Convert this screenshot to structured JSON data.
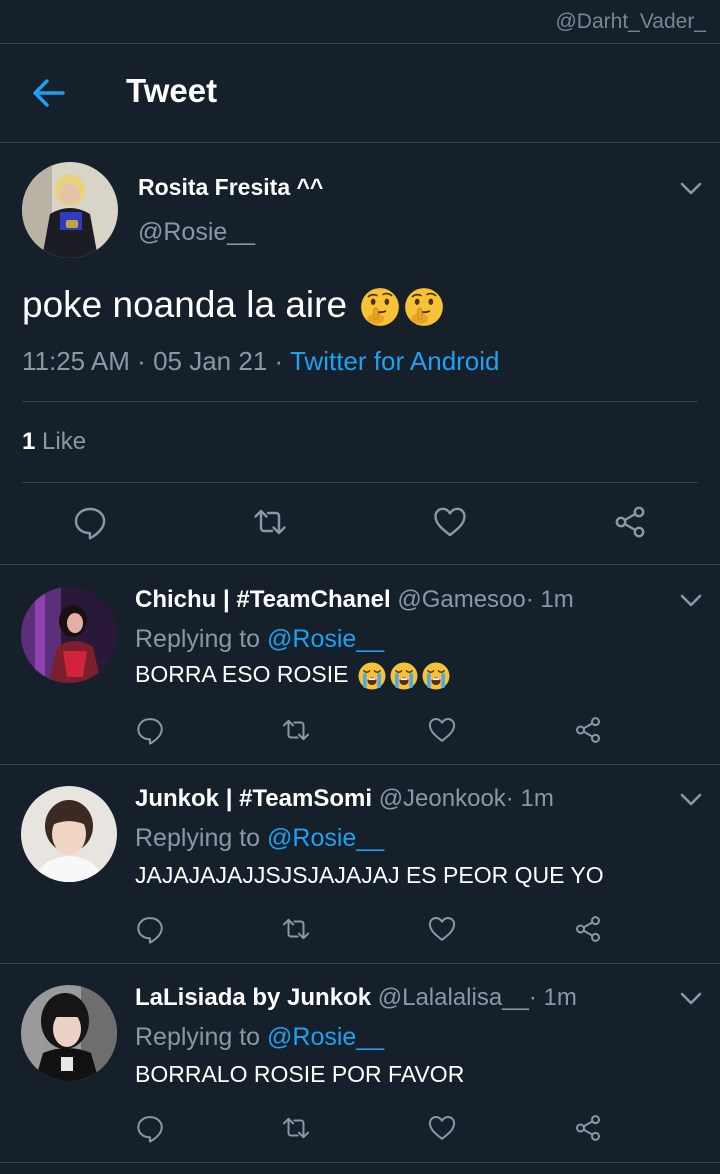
{
  "watermark": "@Darht_Vader_",
  "header": {
    "title": "Tweet"
  },
  "main_tweet": {
    "name": "Rosita Fresita ^^",
    "handle": "@Rosie__",
    "text": "poke noanda la aire",
    "time": "11:25 AM",
    "sep1": "·",
    "date": "05 Jan 21",
    "sep2": "·",
    "source": "Twitter for Android",
    "like_count": "1",
    "like_label": "Like"
  },
  "replies": [
    {
      "name": "Chichu | #TeamChanel",
      "handle": "@Gamesoo",
      "sep": "·",
      "time": "1m",
      "replying_prefix": "Replying to",
      "mention": "@Rosie__",
      "text": "BORRA ESO ROSIE"
    },
    {
      "name": "Junkok | #TeamSomi",
      "handle": "@Jeonkook",
      "sep": "·",
      "time": "1m",
      "replying_prefix": "Replying to",
      "mention": "@Rosie__",
      "text": "JAJAJAJAJJSJSJAJAJAJ ES PEOR QUE YO"
    },
    {
      "name": "LaLisiada by Junkok",
      "handle": "@Lalalalisa__",
      "sep": "·",
      "time": "1m",
      "replying_prefix": "Replying to",
      "mention": "@Rosie__",
      "text": "BORRALO ROSIE POR FAVOR"
    }
  ],
  "icons": {
    "back": "arrow-left-icon",
    "chevron": "chevron-down-icon",
    "reply": "reply-icon",
    "retweet": "retweet-icon",
    "like": "heart-icon",
    "share": "share-icon",
    "emoji_thinking": "shushing-face-emoji",
    "emoji_cry": "crying-face-emoji"
  },
  "colors": {
    "background": "#15202b",
    "accent": "#1da1f2",
    "muted": "#8899a6",
    "divider": "#38444d"
  }
}
